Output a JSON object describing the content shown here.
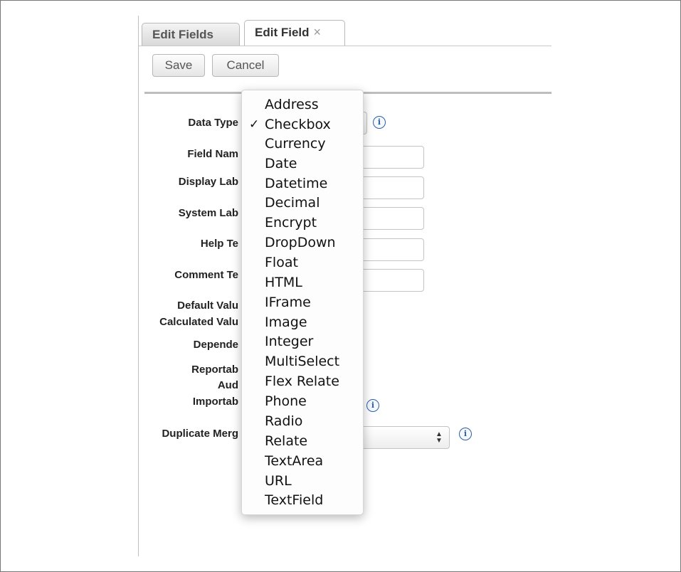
{
  "tabs": [
    {
      "label": "Edit Fields",
      "active": false
    },
    {
      "label": "Edit Field",
      "active": true,
      "close": "×"
    }
  ],
  "toolbar": {
    "save_label": "Save",
    "cancel_label": "Cancel"
  },
  "form": {
    "labels": [
      "Data Type",
      "Field Nam",
      "Display Lab",
      "System Lab",
      "Help Te",
      "Comment Te",
      "Default Valu",
      "Calculated Valu",
      "Depende",
      "Reportab",
      "Aud",
      "Importab",
      "Duplicate Merg"
    ]
  },
  "dropdown": {
    "selected": "Checkbox",
    "check_mark": "✓",
    "options": [
      "Address",
      "Checkbox",
      "Currency",
      "Date",
      "Datetime",
      "Decimal",
      "Encrypt",
      "DropDown",
      "Float",
      "HTML",
      "IFrame",
      "Image",
      "Integer",
      "MultiSelect",
      "Flex Relate",
      "Phone",
      "Radio",
      "Relate",
      "TextArea",
      "URL",
      "TextField"
    ]
  },
  "icons": {
    "info": "i"
  },
  "colors": {
    "info_blue": "#2b5fa8",
    "separator": "#bdbdbd"
  }
}
